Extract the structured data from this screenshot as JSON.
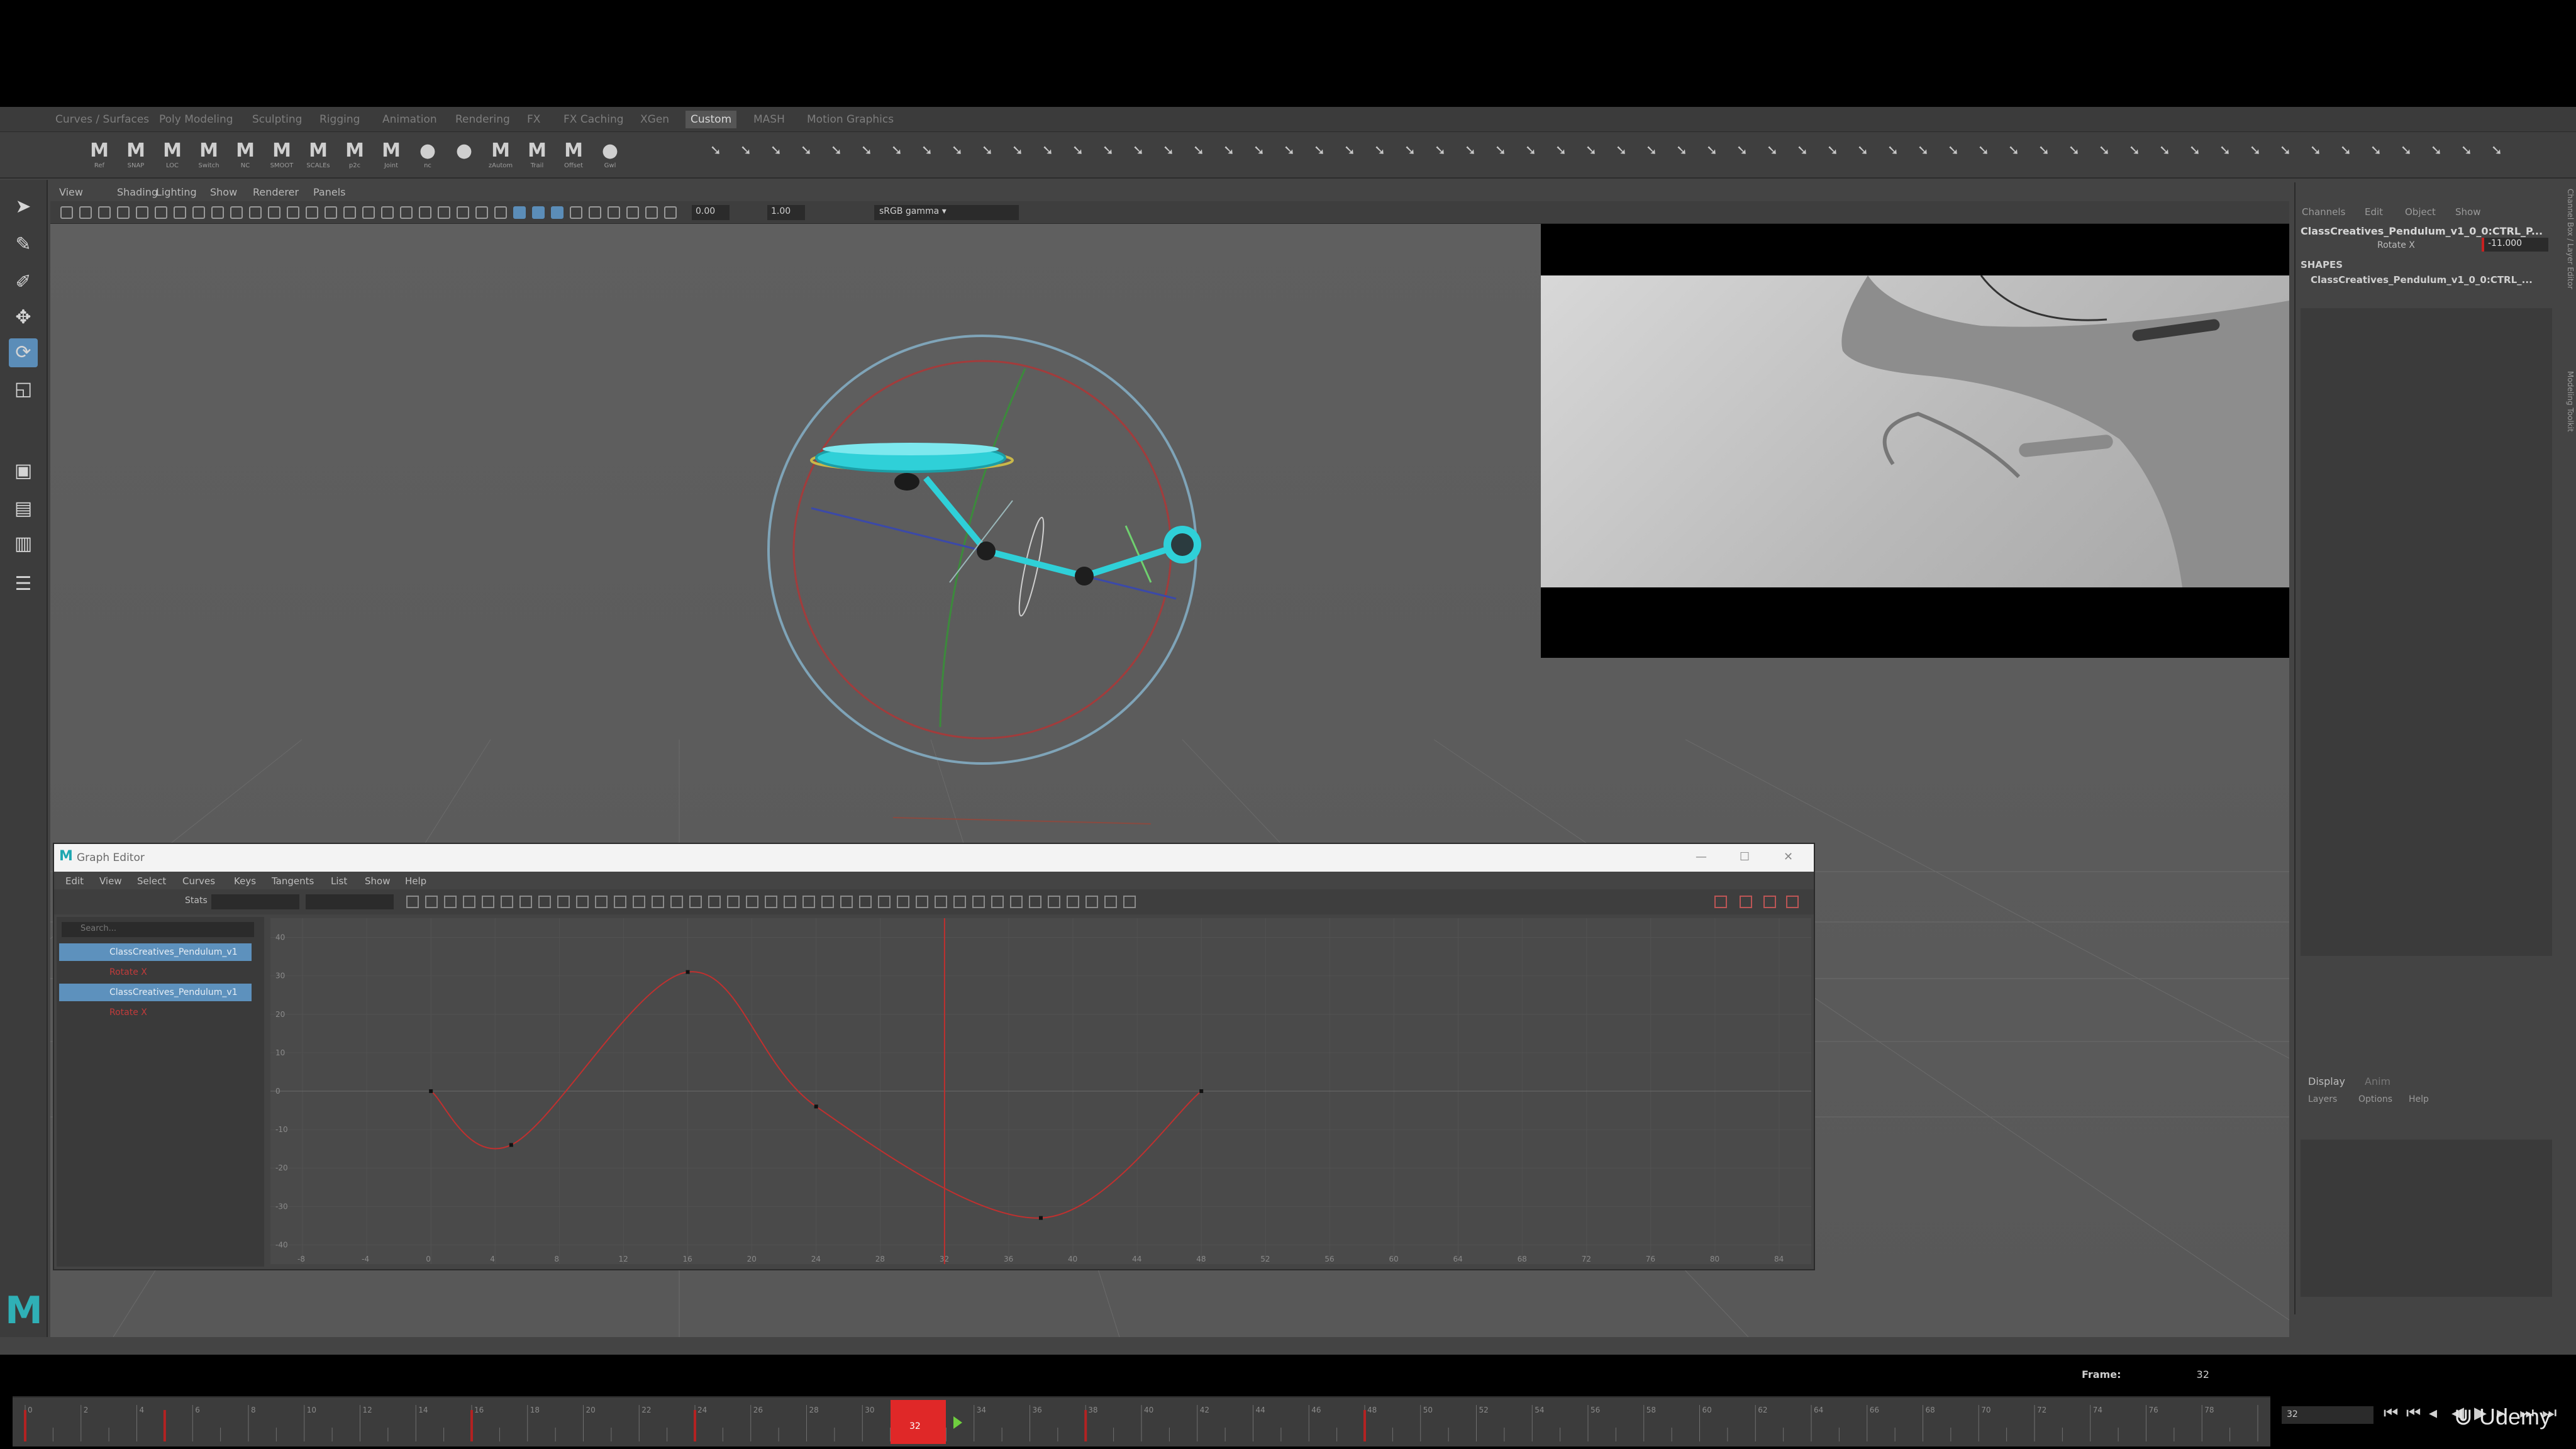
{
  "shelf": {
    "tabs": [
      "Curves / Surfaces",
      "Poly Modeling",
      "Sculpting",
      "Rigging",
      "Animation",
      "Rendering",
      "FX",
      "FX Caching",
      "XGen",
      "Custom",
      "MASH",
      "Motion Graphics"
    ],
    "active_tab": "Custom",
    "icons": [
      {
        "glyph": "M",
        "label": "Ref"
      },
      {
        "glyph": "M",
        "label": "SNAP"
      },
      {
        "glyph": "M",
        "label": "LOC"
      },
      {
        "glyph": "M",
        "label": "Switch"
      },
      {
        "glyph": "M",
        "label": "NC"
      },
      {
        "glyph": "M",
        "label": "SMOOT"
      },
      {
        "glyph": "M",
        "label": "SCALEs"
      },
      {
        "glyph": "M",
        "label": "p2c"
      },
      {
        "glyph": "M",
        "label": "Joint"
      },
      {
        "glyph": "●",
        "label": "nc"
      },
      {
        "glyph": "●",
        "label": ""
      },
      {
        "glyph": "M",
        "label": "zAutom"
      },
      {
        "glyph": "M",
        "label": "Trail"
      },
      {
        "glyph": "M",
        "label": "Offset"
      },
      {
        "glyph": "●",
        "label": "Gwl"
      }
    ]
  },
  "toolbox": {
    "tools": [
      {
        "name": "select-tool",
        "glyph": "➤"
      },
      {
        "name": "lasso-tool",
        "glyph": "✎"
      },
      {
        "name": "paint-tool",
        "glyph": "✐"
      },
      {
        "name": "move-tool",
        "glyph": "✥"
      },
      {
        "name": "rotate-tool",
        "glyph": "⟳"
      },
      {
        "name": "scale-tool",
        "glyph": "◱"
      },
      {
        "name": "layout-single-tool",
        "glyph": "▣"
      },
      {
        "name": "layout-four-tool",
        "glyph": "▤"
      },
      {
        "name": "layout-two-tool",
        "glyph": "▥"
      },
      {
        "name": "outliner-tool",
        "glyph": "☰"
      }
    ],
    "active_tool": "rotate-tool",
    "logo": "M"
  },
  "viewport": {
    "menus": [
      "View",
      "Shading",
      "Lighting",
      "Show",
      "Renderer",
      "Panels"
    ],
    "field_a": "0.00",
    "field_b": "1.00",
    "color_space": "sRGB gamma"
  },
  "channel_box": {
    "tabs": [
      "Channels",
      "Edit",
      "Object",
      "Show"
    ],
    "node": "ClassCreatives_Pendulum_v1_0_0:CTRL_P...",
    "attr_label": "Rotate X",
    "attr_value": "-11.000",
    "shapes_header": "SHAPES",
    "shape_name": "ClassCreatives_Pendulum_v1_0_0:CTRL_...",
    "side_tabs": [
      "Channel Box / Layer Editor",
      "Modeling Toolkit"
    ]
  },
  "layer_editor": {
    "tabs": [
      "Display",
      "Anim"
    ],
    "menus": [
      "Layers",
      "Options",
      "Help"
    ]
  },
  "graph_editor": {
    "title": "Graph Editor",
    "menus": [
      "Edit",
      "View",
      "Select",
      "Curves",
      "Keys",
      "Tangents",
      "List",
      "Show",
      "Help"
    ],
    "stats_label": "Stats",
    "search_placeholder": "Search...",
    "outliner": [
      {
        "label": "ClassCreatives_Pendulum_v1",
        "type": "node",
        "selected": true
      },
      {
        "label": "Rotate X",
        "type": "curve",
        "selected": false
      },
      {
        "label": "ClassCreatives_Pendulum_v1",
        "type": "node",
        "selected": true
      },
      {
        "label": "Rotate X",
        "type": "curve",
        "selected": false
      }
    ],
    "y_ticks": [
      "40",
      "30",
      "20",
      "10",
      "0",
      "-10",
      "-20",
      "-30",
      "-40"
    ],
    "x_ticks": [
      "-8",
      "-4",
      "0",
      "4",
      "8",
      "12",
      "16",
      "20",
      "24",
      "28",
      "32",
      "36",
      "40",
      "44",
      "48",
      "52",
      "56",
      "60",
      "64",
      "68",
      "72",
      "76",
      "80",
      "84"
    ],
    "current_frame": 32,
    "curve_color": "#c0302f",
    "keys": [
      {
        "frame": 0,
        "value": 0
      },
      {
        "frame": 5,
        "value": -14
      },
      {
        "frame": 16,
        "value": 31
      },
      {
        "frame": 24,
        "value": -4
      },
      {
        "frame": 38,
        "value": -33
      },
      {
        "frame": 48,
        "value": 0
      }
    ]
  },
  "timeline": {
    "frame_label": "Frame:",
    "frame_value": "32",
    "current_frame_field": "32",
    "ticks": [
      "0",
      "2",
      "4",
      "6",
      "8",
      "10",
      "12",
      "14",
      "16",
      "18",
      "20",
      "22",
      "24",
      "26",
      "28",
      "30",
      "32",
      "34",
      "36",
      "38",
      "40",
      "42",
      "44",
      "46",
      "48",
      "50",
      "52",
      "54",
      "56",
      "58",
      "60",
      "62",
      "64",
      "66",
      "68",
      "70",
      "72",
      "74",
      "76",
      "78"
    ],
    "keyframes": [
      0,
      5,
      16,
      24,
      38,
      48
    ],
    "current": 32,
    "playback_buttons": [
      "⏮",
      "⏪",
      "◀",
      "▶",
      "⏩",
      "⏭"
    ],
    "accent": "#e02828"
  },
  "watermark": "Udemy"
}
